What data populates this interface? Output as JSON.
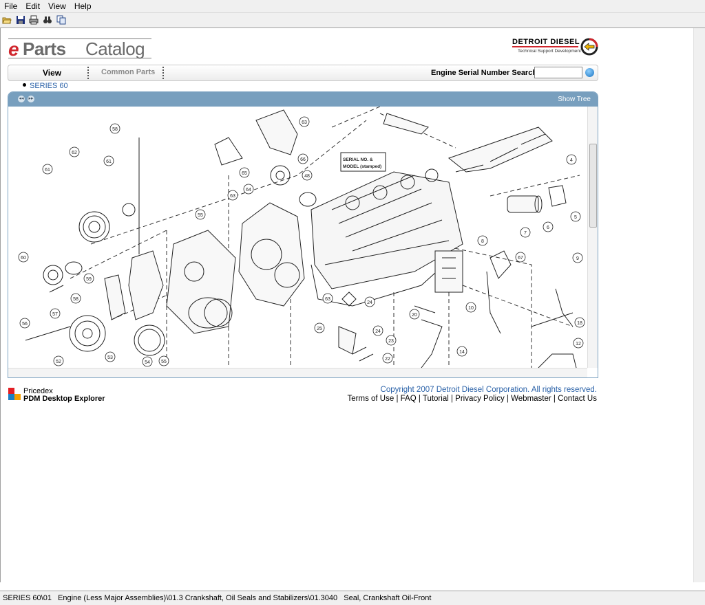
{
  "menu": [
    "File",
    "Edit",
    "View",
    "Help"
  ],
  "toolbar_icons": [
    "open-folder-icon",
    "save-icon",
    "print-icon",
    "find-icon",
    "copy-icon"
  ],
  "logo": {
    "e": "e",
    "parts": "Parts",
    "catalog": "Catalog"
  },
  "brand": {
    "title": "DETROIT DIESEL",
    "subtitle": "Technical Support Development",
    "accent": "#d0262d"
  },
  "nav": {
    "view": "View",
    "common_parts": "Common Parts",
    "search_label": "Engine Serial Number Search",
    "search_value": ""
  },
  "breadcrumb": "SERIES 60",
  "panel": {
    "show_tree": "Show Tree",
    "header_color": "#789fbe"
  },
  "diagram": {
    "label_box": [
      "SERIAL NO. &",
      "MODEL (stamped)"
    ],
    "callouts": [
      "58",
      "62",
      "61",
      "61",
      "60",
      "59",
      "58",
      "57",
      "56",
      "52",
      "53",
      "54",
      "55",
      "55",
      "63",
      "63",
      "65",
      "64",
      "66",
      "48",
      "25",
      "24",
      "24",
      "23",
      "22",
      "20",
      "10",
      "14",
      "12",
      "18",
      "9",
      "8",
      "7",
      "6",
      "5",
      "4",
      "67",
      "55",
      "63"
    ]
  },
  "pricedex": {
    "name": "Pricedex",
    "product": "PDM Desktop Explorer"
  },
  "footer": {
    "copyright": "Copyright 2007 Detroit Diesel Corporation. All rights reserved.",
    "links": [
      "Terms of Use",
      "FAQ",
      "Tutorial",
      "Privacy Policy",
      "Webmaster",
      "Contact Us"
    ],
    "separator": " | "
  },
  "status": "SERIES 60\\01   Engine (Less Major Assemblies)\\01.3 Crankshaft, Oil Seals and Stabilizers\\01.3040   Seal, Crankshaft Oil-Front"
}
